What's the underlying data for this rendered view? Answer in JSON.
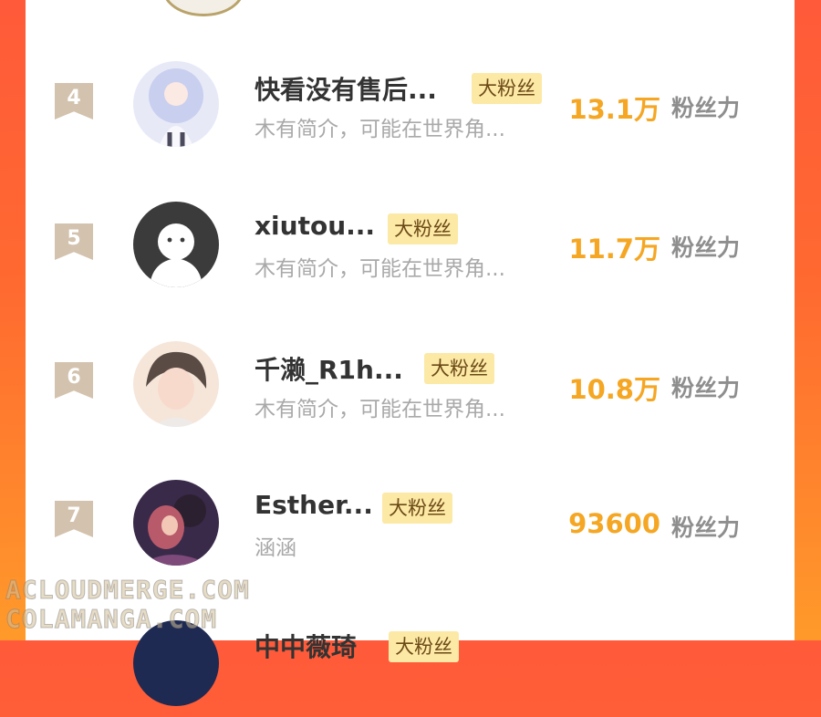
{
  "list": [
    {
      "rank": "4",
      "name": "快看没有售后...",
      "badge": "大粉丝",
      "desc": "木有简介，可能在世界角...",
      "score": "13.1万",
      "score_label": "粉丝力"
    },
    {
      "rank": "5",
      "name": "xiutou...",
      "badge": "大粉丝",
      "desc": "木有简介，可能在世界角...",
      "score": "11.7万",
      "score_label": "粉丝力"
    },
    {
      "rank": "6",
      "name": "千濑_R1h...",
      "badge": "大粉丝",
      "desc": "木有简介，可能在世界角...",
      "score": "10.8万",
      "score_label": "粉丝力"
    },
    {
      "rank": "7",
      "name": "Esther...",
      "badge": "大粉丝",
      "desc": "涵涵",
      "score": "93600",
      "score_label": "粉丝力"
    },
    {
      "rank": "",
      "name": "中中薇琦",
      "badge": "大粉丝",
      "desc": "",
      "score": "",
      "score_label": ""
    }
  ],
  "watermark": {
    "line1": "ACLOUDMERGE.COM",
    "line2": "COLAMANGA.COM"
  },
  "colors": {
    "background_gradient_top": "#ff5a3a",
    "background_gradient_bottom": "#ff9a2a",
    "score": "#f5a623",
    "badge_bg": "#fde9a6",
    "rank_bg": "#d3c2ad"
  }
}
